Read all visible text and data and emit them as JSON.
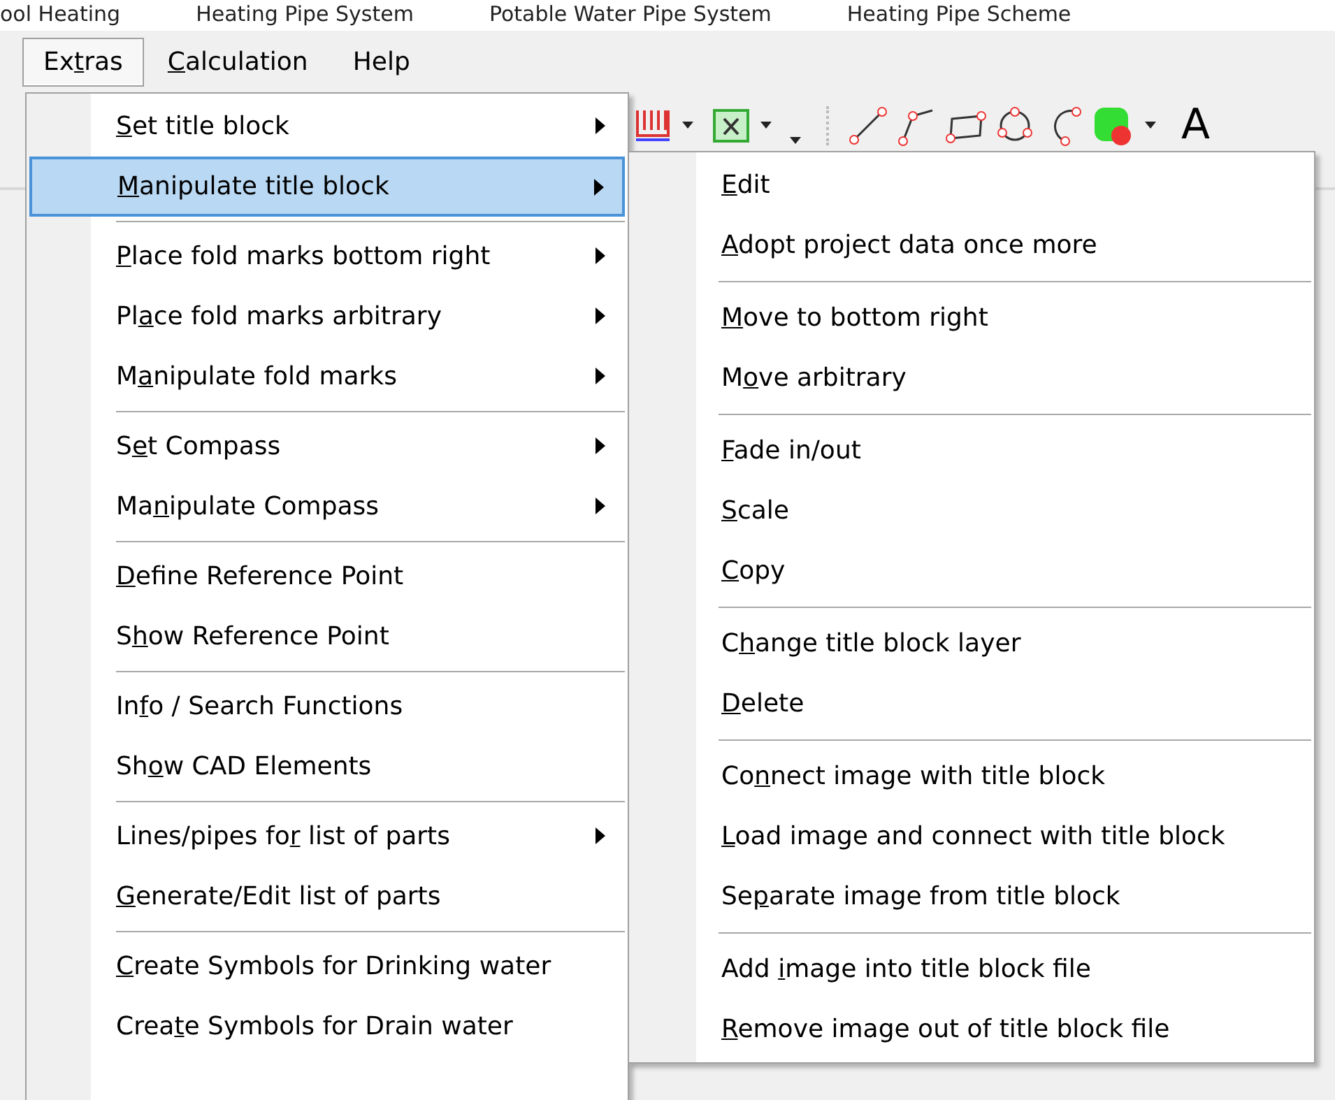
{
  "document_tabs": [
    {
      "label": "ool Heating",
      "selected": false
    },
    {
      "label": "Heating Pipe System",
      "selected": false
    },
    {
      "label": "Potable Water Pipe System",
      "selected": false
    },
    {
      "label": "Heating Pipe Scheme",
      "selected": false
    }
  ],
  "menu_bar": [
    {
      "before": "Ex",
      "key": "t",
      "after": "ras",
      "selected": true
    },
    {
      "key": "C",
      "after": "alculation",
      "selected": false
    },
    {
      "before": "Help",
      "selected": false
    }
  ],
  "toolbar": {
    "text_tool": "A"
  },
  "extras_menu": [
    {
      "kind": "item",
      "key": "S",
      "after": "et title block",
      "submenu": true,
      "selected": false
    },
    {
      "kind": "item",
      "key": "M",
      "after": "anipulate title block",
      "submenu": true,
      "selected": true
    },
    {
      "kind": "separator"
    },
    {
      "kind": "item",
      "key": "P",
      "after": "lace fold marks bottom right",
      "submenu": true,
      "selected": false
    },
    {
      "kind": "item",
      "before": "Pl",
      "key": "a",
      "after": "ce fold marks arbitrary",
      "submenu": true,
      "selected": false
    },
    {
      "kind": "item",
      "before": "M",
      "key": "a",
      "after": "nipulate fold marks",
      "submenu": true,
      "selected": false
    },
    {
      "kind": "separator"
    },
    {
      "kind": "item",
      "before": "S",
      "key": "e",
      "after": "t Compass",
      "submenu": true,
      "selected": false
    },
    {
      "kind": "item",
      "before": "Ma",
      "key": "n",
      "after": "ipulate Compass",
      "submenu": true,
      "selected": false
    },
    {
      "kind": "separator"
    },
    {
      "kind": "item",
      "key": "D",
      "after": "efine Reference Point",
      "submenu": false,
      "selected": false
    },
    {
      "kind": "item",
      "before": "S",
      "key": "h",
      "after": "ow Reference Point",
      "submenu": false,
      "selected": false
    },
    {
      "kind": "separator"
    },
    {
      "kind": "item",
      "before": "In",
      "key": "f",
      "after": "o / Search Functions",
      "submenu": false,
      "selected": false
    },
    {
      "kind": "item",
      "before": "Sh",
      "key": "o",
      "after": "w CAD Elements",
      "submenu": false,
      "selected": false
    },
    {
      "kind": "separator"
    },
    {
      "kind": "item",
      "before": "Lines/pipes fo",
      "key": "r",
      "after": " list of parts",
      "submenu": true,
      "selected": false
    },
    {
      "kind": "item",
      "key": "G",
      "after": "enerate/Edit list of parts",
      "submenu": false,
      "selected": false
    },
    {
      "kind": "separator"
    },
    {
      "kind": "item",
      "key": "C",
      "after": "reate Symbols for Drinking water",
      "submenu": false,
      "selected": false
    },
    {
      "kind": "item",
      "before": "Crea",
      "key": "t",
      "after": "e Symbols for Drain water",
      "submenu": false,
      "selected": false
    }
  ],
  "title_block_submenu": [
    {
      "kind": "item",
      "key": "E",
      "after": "dit",
      "selected": false
    },
    {
      "kind": "item",
      "key": "A",
      "after": "dopt project data once more",
      "selected": false
    },
    {
      "kind": "separator"
    },
    {
      "kind": "item",
      "key": "M",
      "after": "ove to bottom right",
      "selected": false
    },
    {
      "kind": "item",
      "before": "M",
      "key": "o",
      "after": "ve arbitrary",
      "selected": false
    },
    {
      "kind": "separator"
    },
    {
      "kind": "item",
      "key": "F",
      "after": "ade in/out",
      "selected": false
    },
    {
      "kind": "item",
      "key": "S",
      "after": "cale",
      "selected": false
    },
    {
      "kind": "item",
      "key": "C",
      "after": "opy",
      "selected": false
    },
    {
      "kind": "separator"
    },
    {
      "kind": "item",
      "before": "C",
      "key": "h",
      "after": "ange title block layer",
      "selected": false
    },
    {
      "kind": "item",
      "key": "D",
      "after": "elete",
      "selected": false
    },
    {
      "kind": "separator"
    },
    {
      "kind": "item",
      "before": "Co",
      "key": "n",
      "after": "nect image with title block",
      "selected": false
    },
    {
      "kind": "item",
      "key": "L",
      "after": "oad image and connect with title block",
      "selected": false
    },
    {
      "kind": "item",
      "before": "Se",
      "key": "p",
      "after": "arate image from title block",
      "selected": false
    },
    {
      "kind": "separator"
    },
    {
      "kind": "item",
      "before": "Add ",
      "key": "i",
      "after": "mage into title block file",
      "selected": false
    },
    {
      "kind": "item",
      "key": "R",
      "after": "emove image out of title block file",
      "selected": false
    }
  ]
}
